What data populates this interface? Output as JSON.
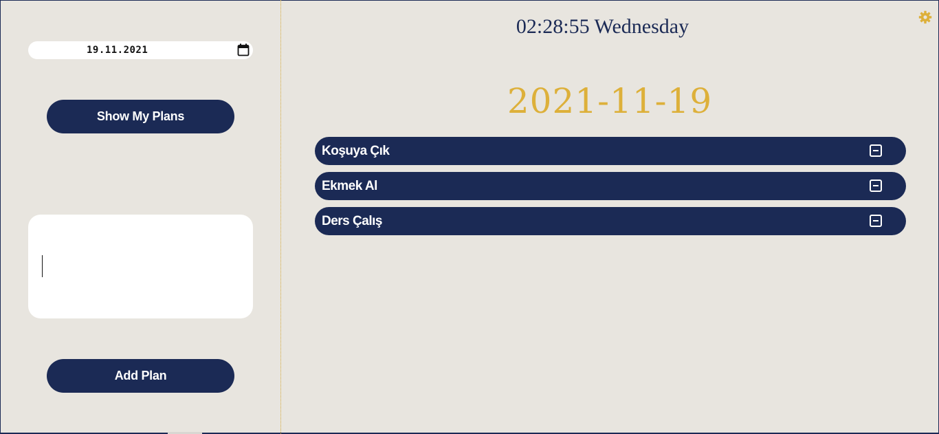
{
  "sidebar": {
    "date_input": {
      "value": "19.11.2021",
      "icon": "calendar-icon"
    },
    "show_plans_label": "Show My Plans",
    "plan_input": {
      "value": "",
      "placeholder": ""
    },
    "add_plan_label": "Add Plan"
  },
  "header": {
    "clock": "02:28:55 Wednesday",
    "settings_icon": "gear-icon"
  },
  "main": {
    "selected_date": "2021-11-19",
    "plans": [
      {
        "label": "Koşuya Çık",
        "action_icon": "minus-square-icon"
      },
      {
        "label": "Ekmek Al",
        "action_icon": "minus-square-icon"
      },
      {
        "label": "Ders Çalış",
        "action_icon": "minus-square-icon"
      }
    ]
  },
  "colors": {
    "navy": "#1b2a55",
    "gold": "#ddb03a",
    "background": "#e8e5df",
    "white": "#ffffff"
  }
}
